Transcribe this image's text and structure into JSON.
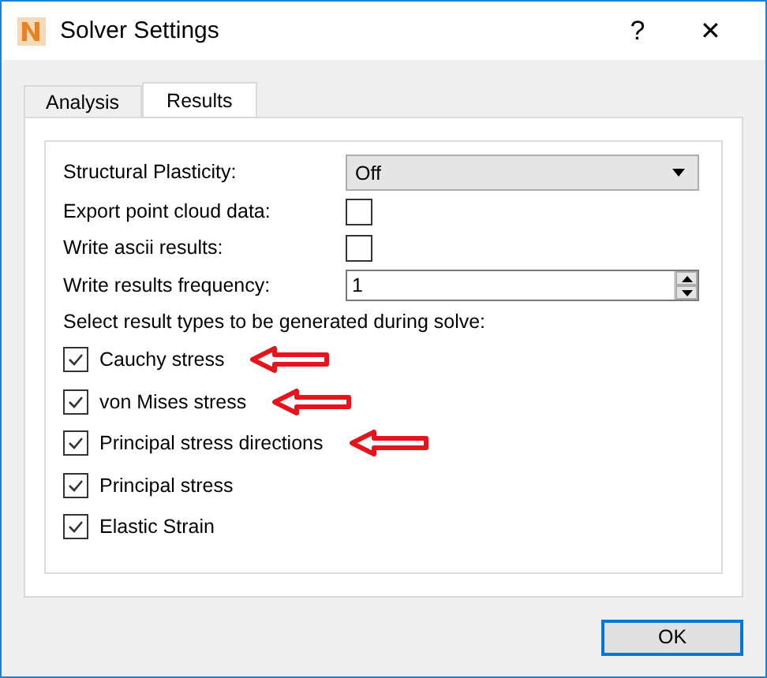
{
  "window": {
    "title": "Solver Settings",
    "help": "?",
    "close": "✕"
  },
  "tabs": [
    {
      "label": "Analysis",
      "selected": false
    },
    {
      "label": "Results",
      "selected": true
    }
  ],
  "settings": [
    {
      "kind": "dropdown",
      "label": "Structural Plasticity:",
      "value": "Off"
    },
    {
      "kind": "checkbox",
      "label": "Export point cloud data:",
      "checked": false
    },
    {
      "kind": "checkbox",
      "label": "Write ascii results:",
      "checked": false
    },
    {
      "kind": "spinner",
      "label": "Write results frequency:",
      "value": "1"
    }
  ],
  "result_types_label": "Select result types to be generated during solve:",
  "result_types": [
    {
      "label": "Cauchy stress",
      "checked": true,
      "marked": true
    },
    {
      "label": "von Mises stress",
      "checked": true,
      "marked": true
    },
    {
      "label": "Principal stress directions",
      "checked": true,
      "marked": true
    },
    {
      "label": "Principal stress",
      "checked": true,
      "marked": false
    },
    {
      "label": "Elastic Strain",
      "checked": true,
      "marked": false
    }
  ],
  "buttons": [
    "OK"
  ]
}
